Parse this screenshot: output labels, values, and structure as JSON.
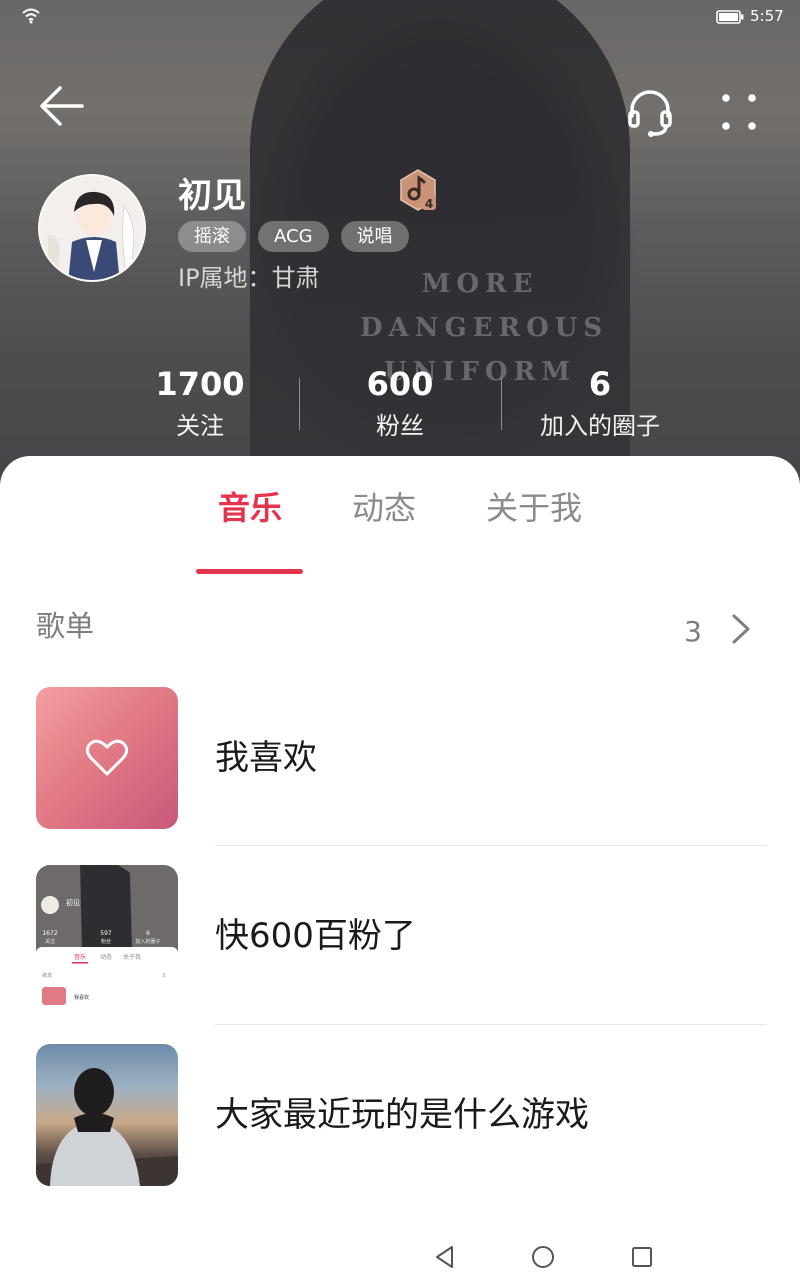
{
  "status_bar": {
    "time": "5:57"
  },
  "profile": {
    "name": "初见",
    "tags": [
      "摇滚",
      "ACG",
      "说唱"
    ],
    "ip_label": "IP属地：",
    "ip_value": "甘肃",
    "level": "4"
  },
  "hero_print": [
    "MORE",
    "DANGEROUS",
    "UNIFORM"
  ],
  "stats": [
    {
      "value": "1700",
      "label": "关注"
    },
    {
      "value": "600",
      "label": "粉丝"
    },
    {
      "value": "6",
      "label": "加入的圈子"
    }
  ],
  "tabs": [
    {
      "label": "音乐",
      "active": true
    },
    {
      "label": "动态",
      "active": false
    },
    {
      "label": "关于我",
      "active": false
    }
  ],
  "playlist_section": {
    "title": "歌单",
    "count": "3"
  },
  "playlists": [
    {
      "name": "我喜欢",
      "cover": "heart-icon"
    },
    {
      "name": "快600百粉了",
      "cover": "profile-screenshot"
    },
    {
      "name": "大家最近玩的是什么游戏",
      "cover": "sunset-photo"
    }
  ],
  "thumb_screenshot": {
    "name": "初见",
    "stats": [
      {
        "value": "1672",
        "label": "关注"
      },
      {
        "value": "597",
        "label": "粉丝"
      },
      {
        "value": "6",
        "label": "加入的圈子"
      }
    ],
    "tabs": [
      "音乐",
      "动态",
      "关于我"
    ],
    "section": "歌单",
    "count": "3",
    "item": "我喜欢"
  },
  "colors": {
    "accent": "#e6334d",
    "text": "#1a1a1a",
    "muted": "#8b8b8b"
  },
  "icons": {
    "back": "arrow-left-icon",
    "headset": "headset-icon",
    "more": "more-dots-icon",
    "level": "music-level-badge-icon",
    "chevron": "chevron-right-icon"
  }
}
